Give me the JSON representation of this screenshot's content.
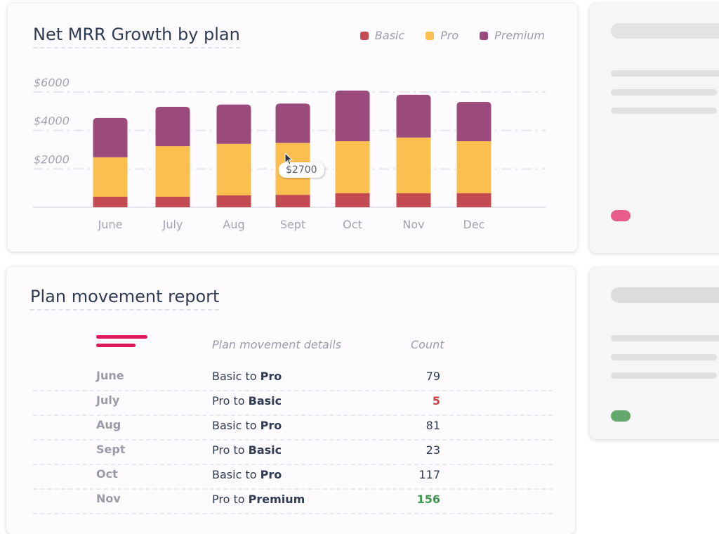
{
  "chart_card": {
    "title": "Net MRR Growth by plan",
    "tooltip": "$2700",
    "colors": {
      "Basic": "#c44a52",
      "Pro": "#fbbf4f",
      "Premium": "#9a4b7b"
    }
  },
  "chart_data": {
    "type": "bar",
    "stacked": true,
    "title": "Net MRR Growth by plan",
    "xlabel": "",
    "ylabel": "",
    "categories": [
      "June",
      "July",
      "Aug",
      "Sept",
      "Oct",
      "Nov",
      "Dec"
    ],
    "series": [
      {
        "name": "Basic",
        "color": "#c44a52",
        "values": [
          550,
          550,
          620,
          650,
          730,
          730,
          730
        ]
      },
      {
        "name": "Pro",
        "color": "#fbbf4f",
        "values": [
          2050,
          2630,
          2680,
          2700,
          2710,
          2900,
          2710
        ]
      },
      {
        "name": "Premium",
        "color": "#9a4b7b",
        "values": [
          2050,
          2050,
          2050,
          2050,
          2640,
          2230,
          2050
        ]
      }
    ],
    "ylim": [
      0,
      6000
    ],
    "yticks": [
      2000,
      4000,
      6000
    ],
    "ytick_labels": [
      "$2000",
      "$4000",
      "$6000"
    ],
    "grid": true,
    "legend": "top-right",
    "tooltip": {
      "category": "Sept",
      "series": "Pro",
      "label": "$2700"
    }
  },
  "table_card": {
    "title": "Plan movement report",
    "headers": {
      "details": "Plan movement details",
      "count": "Count"
    },
    "rows": [
      {
        "month": "June",
        "from": "Basic to ",
        "to": "Pro",
        "count": "79",
        "count_color": "#2d3b55",
        "count_bold": false
      },
      {
        "month": "July",
        "from": "Pro to ",
        "to": "Basic",
        "count": "5",
        "count_color": "#c9413f",
        "count_bold": true
      },
      {
        "month": "Aug",
        "from": "Basic to ",
        "to": "Pro",
        "count": "81",
        "count_color": "#2d3b55",
        "count_bold": false
      },
      {
        "month": "Sept",
        "from": "Pro to ",
        "to": "Basic",
        "count": "23",
        "count_color": "#2d3b55",
        "count_bold": false
      },
      {
        "month": "Oct",
        "from": "Basic to ",
        "to": "Pro",
        "count": "117",
        "count_color": "#2d3b55",
        "count_bold": false
      },
      {
        "month": "Nov",
        "from": "Pro to ",
        "to": "Premium",
        "count": "156",
        "count_color": "#3f9a4f",
        "count_bold": true
      }
    ]
  },
  "side_cards": [
    {
      "badge_color": "#e85b8b"
    },
    {
      "badge_color": "#63a86d"
    }
  ]
}
